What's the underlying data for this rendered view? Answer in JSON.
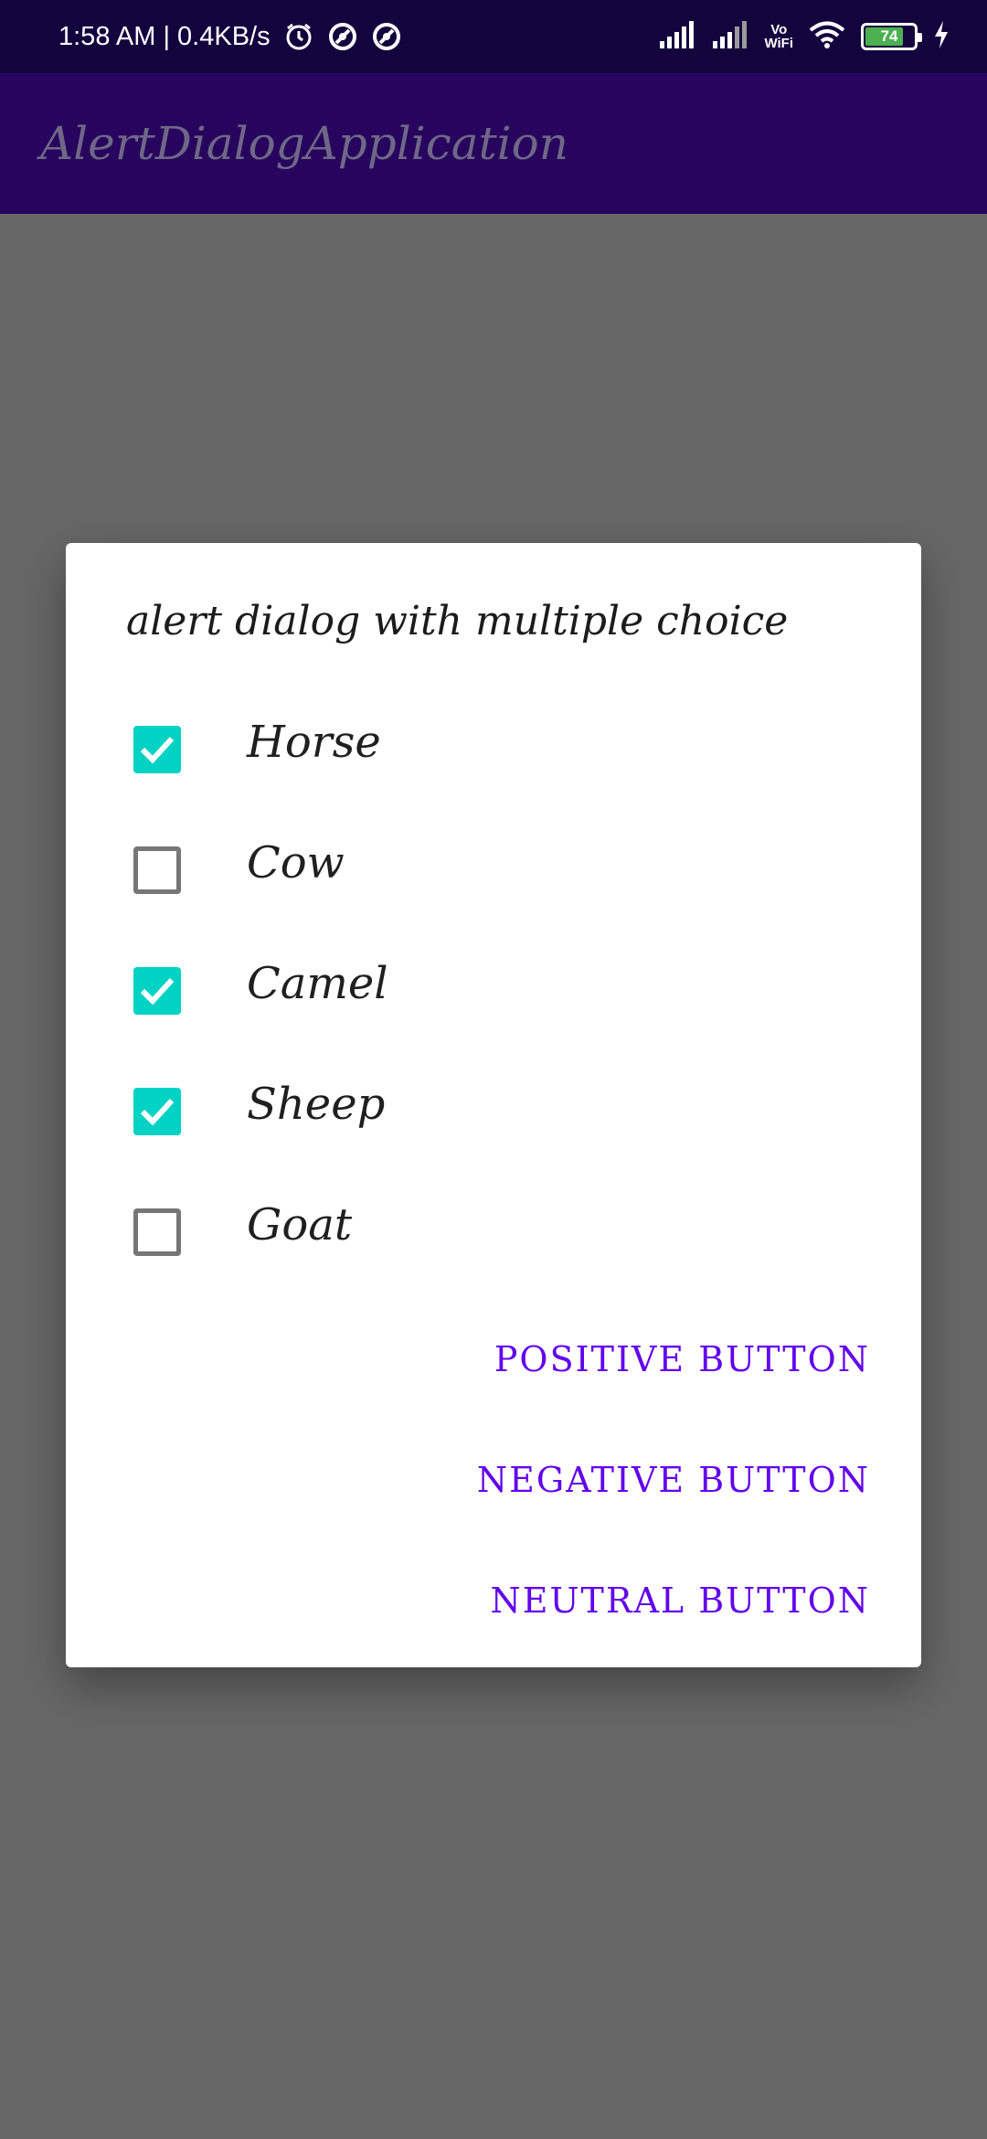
{
  "status_bar": {
    "time_speed": "1:58 AM | 0.4KB/s",
    "battery_level": "74",
    "network_label_top": "Vo",
    "network_label_bottom": "WiFi",
    "icons": [
      "alarm-icon",
      "app-notification-icon",
      "app-notification-icon",
      "signal-icon",
      "signal-icon",
      "wifi-icon",
      "battery-icon",
      "charging-icon"
    ]
  },
  "app_bar": {
    "title": "AlertDialogApplication"
  },
  "dialog": {
    "title": "alert dialog with multiple choice",
    "options": [
      {
        "label": "Horse",
        "checked": true
      },
      {
        "label": "Cow",
        "checked": false
      },
      {
        "label": "Camel",
        "checked": true
      },
      {
        "label": "Sheep",
        "checked": true
      },
      {
        "label": "Goat",
        "checked": false
      }
    ],
    "buttons": {
      "positive": "POSITIVE BUTTON",
      "negative": "NEGATIVE BUTTON",
      "neutral": "NEUTRAL BUTTON"
    }
  },
  "colors": {
    "status_bar": "#14043e",
    "app_bar": "#27045e",
    "checkbox_checked": "#00d2c4",
    "button_text": "#6200ee",
    "scrim": "#676767"
  }
}
